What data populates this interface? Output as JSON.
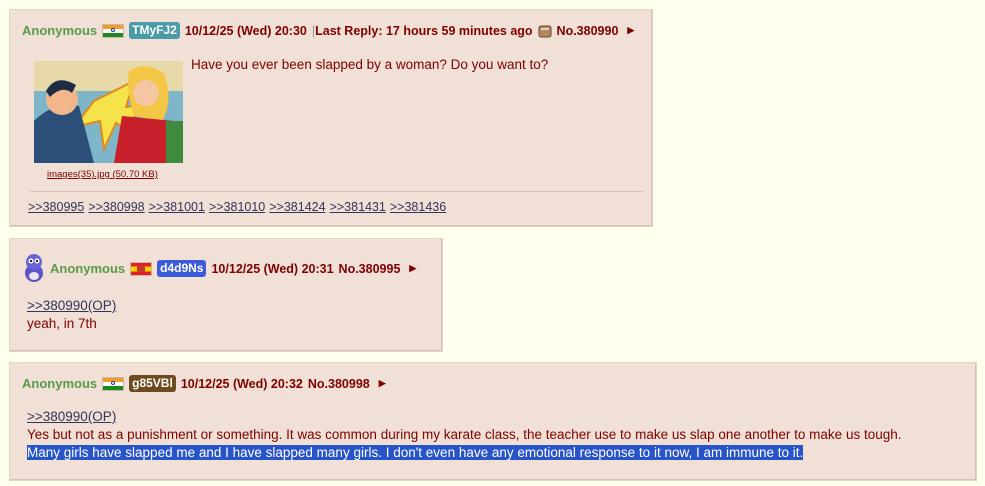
{
  "op": {
    "name": "Anonymous",
    "flag": "india-flag-icon",
    "poster_id": "TMyFJ2",
    "poster_id_color": "#4A9BA8",
    "date": "10/12/25 (Wed) 20:30",
    "separator": " | ",
    "last_reply": "Last Reply: 17 hours 59 minutes ago",
    "post_no": "No.380990",
    "text": "Have you ever been slapped by a woman? Do you want to?",
    "file_label": "images(35).jpg (50.70 KB)",
    "replies": [
      ">>380995",
      ">>380998",
      ">>381001",
      ">>381010",
      ">>381424",
      ">>381431",
      ">>381436"
    ]
  },
  "reply1": {
    "name": "Anonymous",
    "flag": "sikkim-flag-icon",
    "poster_id": "d4d9Ns",
    "poster_id_color": "#3B5BDB",
    "date": "10/12/25 (Wed) 20:31",
    "post_no": "No.380995",
    "quote": ">>380990(OP)",
    "text": "yeah, in 7th"
  },
  "reply2": {
    "name": "Anonymous",
    "flag": "india-flag-icon",
    "poster_id": "g85VBl",
    "poster_id_color": "#6E4A1E",
    "date": "10/12/25 (Wed) 20:32",
    "post_no": "No.380998",
    "quote": ">>380990(OP)",
    "line1": "Yes but not as a punishment or something. It was common during my karate class, the teacher use to make us slap one another to make us tough.",
    "line2": "Many girls have slapped me and I have slapped many girls. I don't even have any emotional response to it now, I am immune to it."
  },
  "colors": {
    "page_bg": "#FFFFEE",
    "post_bg": "#F0E0D6",
    "name": "#5A9A4A",
    "text": "#800000",
    "link": "#34345C",
    "selection": "#2755C9"
  }
}
